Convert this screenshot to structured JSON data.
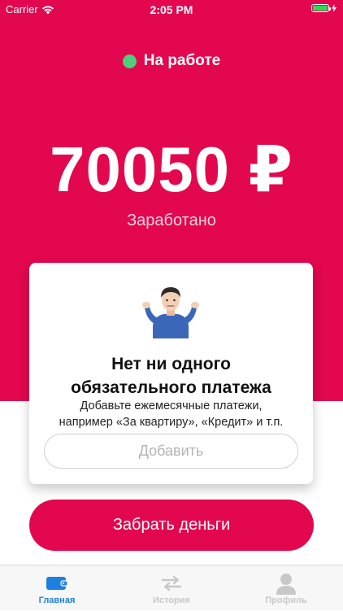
{
  "status_bar": {
    "carrier": "Carrier",
    "time": "2:05 PM"
  },
  "work_status": {
    "label": "На работе",
    "dot_color": "#4cd07a"
  },
  "earnings": {
    "amount": "70050 ₽",
    "label": "Заработано"
  },
  "payments_card": {
    "emoji_icon": "person-shrugging-icon",
    "title_line1": "Нет ни одного",
    "title_line2": "обязательного платежа",
    "subtitle_line1": "Добавьте ежемесячные платежи,",
    "subtitle_line2": "например «За квартиру», «Кредит» и т.п.",
    "add_button": "Добавить"
  },
  "withdraw_button": "Забрать деньги",
  "tabs": [
    {
      "label": "Главная",
      "icon": "wallet-icon",
      "active": true
    },
    {
      "label": "История",
      "icon": "transfer-arrows-icon",
      "active": false
    },
    {
      "label": "Профиль",
      "icon": "person-icon",
      "active": false
    }
  ],
  "colors": {
    "accent": "#e2074f",
    "active_tab": "#1f7fe0",
    "inactive_tab": "#c8c8c8"
  }
}
